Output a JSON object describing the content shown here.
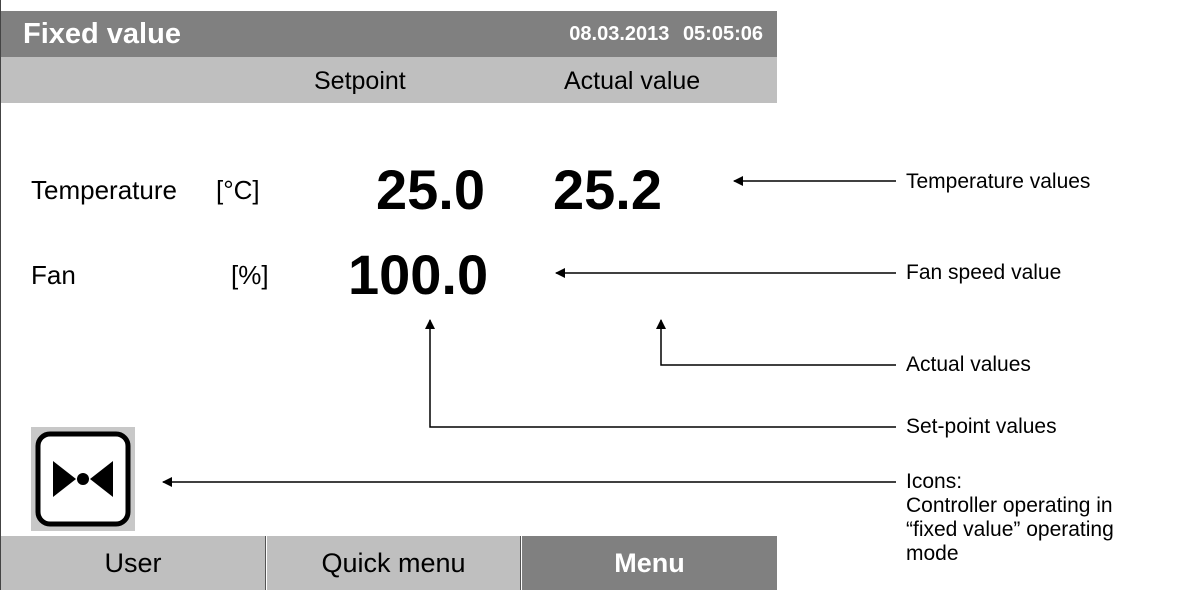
{
  "title_bar": {
    "title": "Fixed value",
    "date": "08.03.2013",
    "time": "05:05:06",
    "bg_color": "#808080"
  },
  "column_headers": {
    "setpoint": "Setpoint",
    "actual": "Actual value"
  },
  "rows": [
    {
      "label": "Temperature",
      "unit": "[°C]",
      "setpoint": "25.0",
      "actual": "25.2"
    },
    {
      "label": "Fan",
      "unit": "[%]",
      "setpoint": "100.0",
      "actual": ""
    }
  ],
  "mode_icon": {
    "name": "fixed-value-mode-icon"
  },
  "bottom_buttons": {
    "user": "User",
    "quick_menu": "Quick menu",
    "menu": "Menu"
  },
  "annotations": {
    "temperature_values": "Temperature values",
    "fan_speed_value": "Fan speed value",
    "actual_values": "Actual values",
    "setpoint_values": "Set-point values",
    "icons_line1": "Icons:",
    "icons_line2": "Controller operating in",
    "icons_line3": "“fixed value” operating",
    "icons_line4": "mode"
  }
}
